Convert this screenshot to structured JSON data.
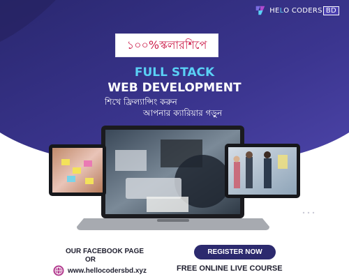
{
  "brand": {
    "logo_text": "HELLO CODERS",
    "logo_prefix": "HE",
    "logo_middle": "L",
    "logo_rest": "O CODERS",
    "logo_box": "BD"
  },
  "scholarship_label": "১০০%স্কলারশিপে",
  "headline": {
    "line1": "FULL STACK",
    "line2": "WEB DEVELOPMENT"
  },
  "tagline": {
    "line1": "শিখে ফ্রিল্যান্সিং করুন",
    "line2": "আপনার ক্যারিয়ার গড়ুন"
  },
  "facebook_label": "OUR FACEBOOK PAGE",
  "or_label": "OR",
  "website": "www.hellocodersbd.xyz",
  "register_label": "REGISTER NOW",
  "course_label": "FREE ONLINE LIVE COURSE",
  "colors": {
    "background_dark": "#2c2a6e",
    "background_mid": "#433e9a",
    "accent_cyan": "#5ad0f5",
    "accent_red": "#cc1c4a",
    "text_dark": "#1e1e2e"
  },
  "icons": {
    "logo": "hello-coders-logo-icon",
    "globe": "globe-icon"
  }
}
